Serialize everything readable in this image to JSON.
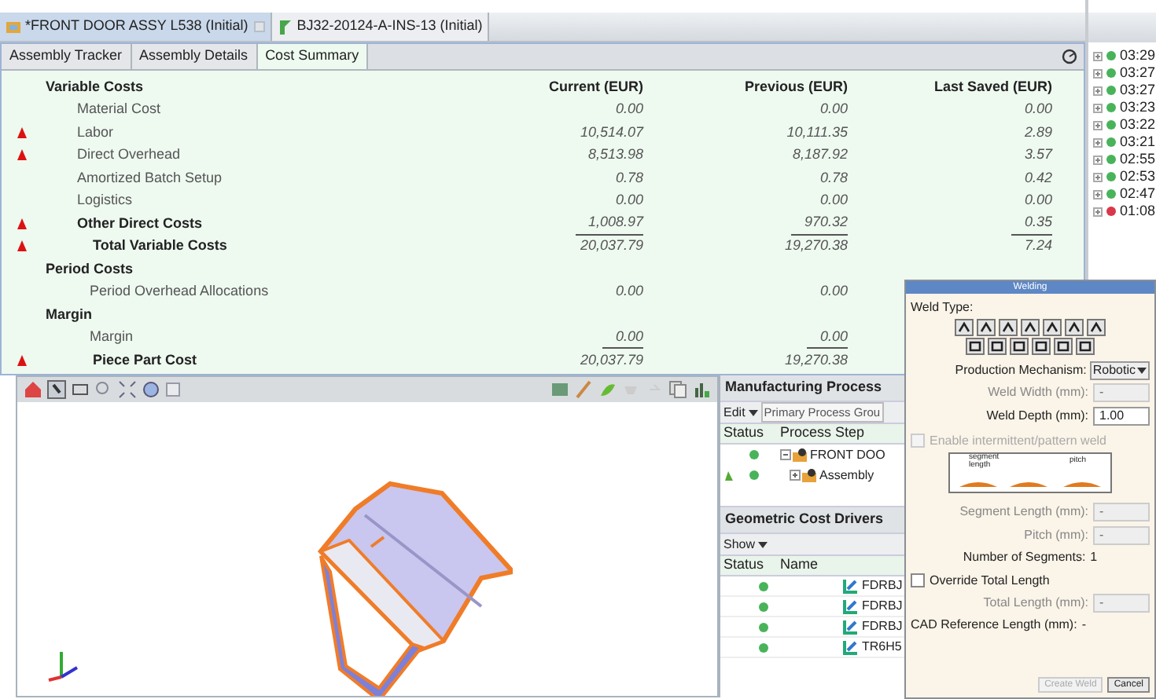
{
  "document_tabs": [
    {
      "label": "*FRONT DOOR ASSY L538 (Initial)",
      "selected": true
    },
    {
      "label": "BJ32-20124-A-INS-13 (Initial)",
      "selected": false
    }
  ],
  "view_tabs": [
    {
      "label": "Assembly Tracker",
      "selected": false
    },
    {
      "label": "Assembly Details",
      "selected": false
    },
    {
      "label": "Cost Summary",
      "selected": true
    }
  ],
  "cost_table": {
    "columns": [
      "Current (EUR)",
      "Previous (EUR)",
      "Last Saved (EUR)"
    ],
    "rows": [
      {
        "kind": "section",
        "label": "Variable Costs",
        "flag": false
      },
      {
        "kind": "item",
        "label": "Material Cost",
        "flag": false,
        "current": "0.00",
        "previous": "0.00",
        "last_saved": "0.00"
      },
      {
        "kind": "item",
        "label": "Labor",
        "flag": true,
        "current": "10,514.07",
        "previous": "10,111.35",
        "last_saved": "2.89"
      },
      {
        "kind": "item",
        "label": "Direct Overhead",
        "flag": true,
        "current": "8,513.98",
        "previous": "8,187.92",
        "last_saved": "3.57"
      },
      {
        "kind": "item",
        "label": "Amortized Batch Setup",
        "flag": false,
        "current": "0.78",
        "previous": "0.78",
        "last_saved": "0.42"
      },
      {
        "kind": "item",
        "label": "Logistics",
        "flag": false,
        "current": "0.00",
        "previous": "0.00",
        "last_saved": "0.00"
      },
      {
        "kind": "subtotal",
        "label": "Other Direct Costs",
        "flag": true,
        "current": "1,008.97",
        "previous": "970.32",
        "last_saved": "0.35",
        "rule_below": true
      },
      {
        "kind": "total",
        "label": "Total Variable Costs",
        "flag": true,
        "current": "20,037.79",
        "previous": "19,270.38",
        "last_saved": "7.24"
      },
      {
        "kind": "section",
        "label": "Period Costs",
        "flag": false
      },
      {
        "kind": "sub_item",
        "label": "Period Overhead Allocations",
        "flag": false,
        "current": "0.00",
        "previous": "0.00"
      },
      {
        "kind": "section",
        "label": "Margin",
        "flag": false
      },
      {
        "kind": "sub_item",
        "label": "Margin",
        "flag": false,
        "current": "0.00",
        "previous": "0.00",
        "rule_below": true
      },
      {
        "kind": "total",
        "label": "Piece Part Cost",
        "flag": true,
        "current": "20,037.79",
        "previous": "19,270.38"
      }
    ]
  },
  "history": [
    {
      "time": "03:29",
      "color": "#49b35a"
    },
    {
      "time": "03:27",
      "color": "#49b35a"
    },
    {
      "time": "03:27",
      "color": "#49b35a"
    },
    {
      "time": "03:23",
      "color": "#49b35a"
    },
    {
      "time": "03:22",
      "color": "#49b35a"
    },
    {
      "time": "03:21",
      "color": "#49b35a"
    },
    {
      "time": "02:55",
      "color": "#49b35a"
    },
    {
      "time": "02:53",
      "color": "#49b35a"
    },
    {
      "time": "02:47",
      "color": "#49b35a"
    },
    {
      "time": "01:08",
      "color": "#d9384a"
    }
  ],
  "manufacturing_process": {
    "title": "Manufacturing Process",
    "edit_menu": "Edit",
    "process_group": "Primary Process Grou",
    "columns": [
      "Status",
      "Process Step"
    ],
    "rows": [
      {
        "label": "FRONT DOO",
        "expanded": true,
        "flag": false
      },
      {
        "label": "Assembly",
        "expanded": false,
        "flag": true
      }
    ]
  },
  "geometric_cost_drivers": {
    "title": "Geometric Cost Drivers",
    "show_menu": "Show",
    "columns": [
      "Status",
      "Name"
    ],
    "rows": [
      {
        "label": "FDRBJ"
      },
      {
        "label": "FDRBJ"
      },
      {
        "label": "FDRBJ"
      },
      {
        "label": "TR6H5"
      }
    ]
  },
  "welding_dialog": {
    "title": "Welding",
    "weld_type_label": "Weld Type:",
    "production_mechanism": {
      "label": "Production Mechanism:",
      "value": "Robotic"
    },
    "fields_top": [
      {
        "label": "Weld Width (mm):",
        "placeholder": "-",
        "disabled": true
      },
      {
        "label": "Weld Depth (mm):",
        "value": "1.00",
        "disabled": false
      }
    ],
    "pattern_checkbox": {
      "label": "Enable intermittent/pattern weld",
      "checked": false,
      "disabled": true
    },
    "diagram_labels": {
      "segment": "segment length",
      "pitch": "pitch"
    },
    "fields_pattern": [
      {
        "label": "Segment Length (mm):",
        "placeholder": "-",
        "disabled": true
      },
      {
        "label": "Pitch (mm):",
        "placeholder": "-",
        "disabled": true
      }
    ],
    "segments": {
      "label": "Number of Segments:",
      "value": "1"
    },
    "override_checkbox": {
      "label": "Override Total Length",
      "checked": false,
      "disabled": false
    },
    "total_length": {
      "label": "Total Length (mm):",
      "placeholder": "-",
      "disabled": true
    },
    "cad_reference": {
      "label": "CAD Reference Length (mm):",
      "value": "-"
    },
    "buttons": [
      {
        "label": "Create Weld",
        "disabled": true
      },
      {
        "label": "Cancel",
        "disabled": false
      }
    ]
  }
}
